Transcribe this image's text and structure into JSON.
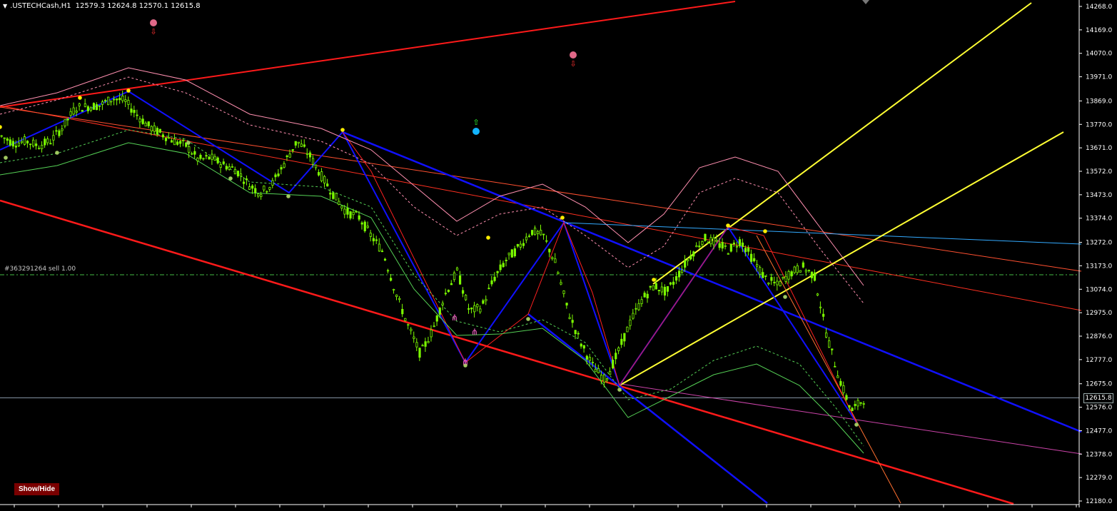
{
  "header": {
    "symbol": ".USTECHCash,H1",
    "ohlc": "12579.3 12624.8 12570.1 12615.8"
  },
  "order_line": {
    "label": "#363291264 sell 1.00"
  },
  "current_price": "12615.8",
  "show_hide_button": "Show/Hide",
  "colors": {
    "background": "#000000",
    "candle": "#7CFC00",
    "red_line": "#ff1a1a",
    "blue_line": "#1010ff",
    "yellow_line": "#ffff33",
    "envelope_pink": "#ff8fb0",
    "envelope_green": "#55d055"
  },
  "chart_data": {
    "type": "candlestick",
    "symbol": ".USTECHCash",
    "timeframe": "H1",
    "ylim": [
      12180.0,
      14268.0
    ],
    "y_ticks": [
      "14268.0",
      "14169.0",
      "14070.0",
      "13971.0",
      "13869.0",
      "13770.0",
      "13671.0",
      "13572.0",
      "13473.0",
      "13374.0",
      "13272.0",
      "13173.0",
      "13074.0",
      "12975.0",
      "12876.0",
      "12777.0",
      "12675.0",
      "12576.0",
      "12477.0",
      "12378.0",
      "12279.0",
      "12180.0"
    ],
    "last_price": 12615.8,
    "order_price": 13135.0,
    "close_path": [
      13720,
      13690,
      13700,
      13680,
      13700,
      13760,
      13840,
      13845,
      13850,
      13880,
      13870,
      13810,
      13760,
      13730,
      13700,
      13680,
      13620,
      13630,
      13600,
      13580,
      13520,
      13480,
      13520,
      13610,
      13700,
      13640,
      13550,
      13470,
      13400,
      13380,
      13300,
      13230,
      13060,
      12920,
      12800,
      12900,
      13050,
      13150,
      12980,
      13000,
      13120,
      13200,
      13250,
      13320,
      13300,
      13180,
      12980,
      12850,
      12750,
      12690,
      12800,
      12930,
      13030,
      13090,
      13060,
      13140,
      13220,
      13290,
      13270,
      13240,
      13280,
      13200,
      13120,
      13090,
      13140,
      13170,
      13130,
      12880,
      12700,
      12560,
      12610
    ]
  }
}
